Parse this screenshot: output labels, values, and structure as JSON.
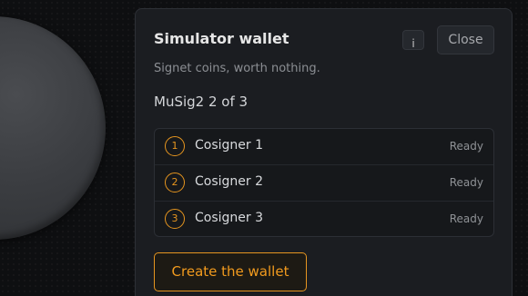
{
  "dialog": {
    "title": "Simulator wallet",
    "info_label": "i",
    "close_label": "Close",
    "subtitle": "Signet coins, worth nothing.",
    "scheme": "MuSig2 2 of 3",
    "cosigners": [
      {
        "number": "1",
        "name": "Cosigner 1",
        "status": "Ready"
      },
      {
        "number": "2",
        "name": "Cosigner 2",
        "status": "Ready"
      },
      {
        "number": "3",
        "name": "Cosigner 3",
        "status": "Ready"
      }
    ],
    "create_label": "Create the wallet"
  },
  "colors": {
    "accent": "#f29b1e",
    "panel": "#1b1d21",
    "background": "#0e0f11"
  }
}
